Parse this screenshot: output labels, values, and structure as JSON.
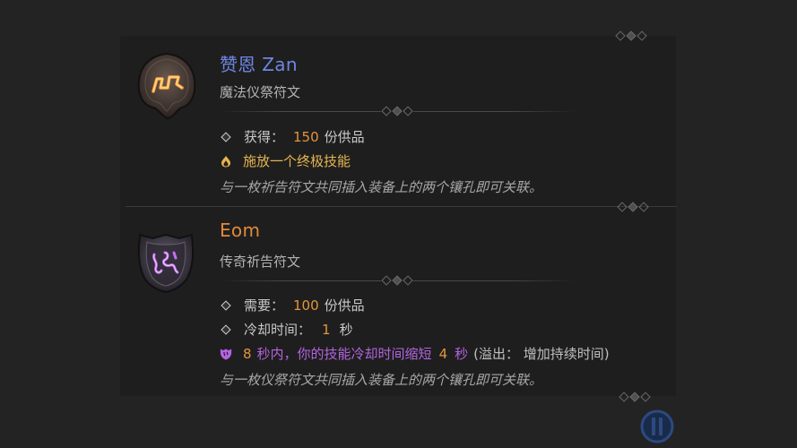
{
  "items": [
    {
      "title": "赞恩 Zan",
      "type": "魔法仪祭符文",
      "stats": [
        {
          "label": "获得：",
          "value": "150",
          "suffix": "份供品"
        }
      ],
      "effect": {
        "icon": "flame-icon",
        "text": "施放一个终极技能"
      },
      "description": "与一枚祈告符文共同插入装备上的两个镶孔即可关联。",
      "rune_icon": "orange-rune-icon"
    },
    {
      "title": "Eom",
      "type": "传奇祈告符文",
      "stats": [
        {
          "label": "需要：",
          "value": "100",
          "suffix": "份供品"
        },
        {
          "label": "冷却时间：",
          "value": "1",
          "suffix": "秒"
        }
      ],
      "effect": {
        "icon": "shield-icon",
        "pre_num": "8",
        "text_a": "秒内，你的技能冷却时间缩短",
        "mid_num": "4",
        "text_b": "秒",
        "overflow": "(溢出：  增加持续时间)"
      },
      "description": "与一枚仪祭符文共同插入装备上的两个镶孔即可关联。",
      "rune_icon": "purple-rune-icon"
    }
  ],
  "colors": {
    "title_magic": "#6f86e3",
    "title_legendary": "#e08a3a",
    "value_orange": "#e3953c",
    "effect_gold": "#e6b552",
    "effect_purple": "#b264e0"
  }
}
